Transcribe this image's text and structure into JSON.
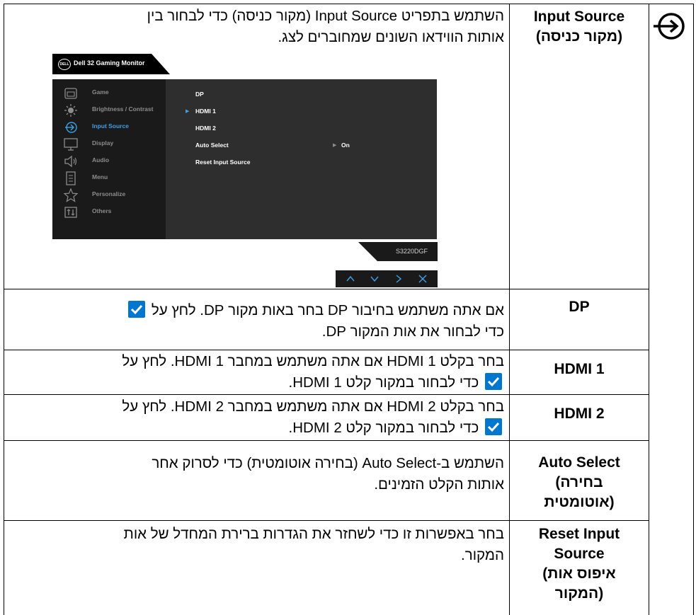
{
  "page": {
    "side_icon": "input-source-icon",
    "rows": [
      {
        "id": "input-source",
        "label_en": "Input Source",
        "label_he": "(מקור כניסה)",
        "desc": [
          "השתמש בתפריט Input Source (מקור כניסה) כדי לבחור בין",
          "אותות הווידאו השונים שמחוברים לצג."
        ]
      },
      {
        "id": "dp",
        "label_en": "DP",
        "desc_a": "אם אתה משתמש בחיבור DP בחר באות מקור DP. לחץ על",
        "desc_b": "כדי לבחור את אות המקור DP."
      },
      {
        "id": "hdmi1",
        "label_en": "HDMI 1",
        "desc_a": "בחר בקלט HDMI 1 אם אתה משתמש במחבר HDMI 1. לחץ על",
        "desc_b": "כדי לבחור במקור קלט HDMI 1."
      },
      {
        "id": "hdmi2",
        "label_en": "HDMI 2",
        "desc_a": "בחר בקלט HDMI 2 אם אתה משתמש במחבר HDMI 2. לחץ על",
        "desc_b": "כדי לבחור במקור קלט HDMI 2."
      },
      {
        "id": "auto-select",
        "label_en": "Auto Select",
        "label_he_1": "(בחירה",
        "label_he_2": "אוטומטית)",
        "desc": [
          "השתמש ב-Auto Select (בחירה אוטומטית) כדי לסרוק אחר",
          "אותות הקלט הזמינים."
        ]
      },
      {
        "id": "reset-input-source",
        "label_en_1": "Reset Input",
        "label_en_2": "Source",
        "label_he_1": "(איפוס אות",
        "label_he_2": "המקור)",
        "desc": [
          "בחר באפשרות זו כדי לשחזר את הגדרות ברירת המחדל של אות",
          "המקור."
        ]
      }
    ]
  },
  "osd": {
    "title": "Dell 32 Gaming Monitor",
    "logo": "DELL",
    "menu": [
      {
        "label": "Game",
        "icon": "game-icon",
        "active": false
      },
      {
        "label": "Brightness / Contrast",
        "icon": "brightness-icon",
        "active": false
      },
      {
        "label": "Input Source",
        "icon": "input-source-icon",
        "active": true
      },
      {
        "label": "Display",
        "icon": "display-icon",
        "active": false
      },
      {
        "label": "Audio",
        "icon": "audio-icon",
        "active": false
      },
      {
        "label": "Menu",
        "icon": "menu-icon",
        "active": false
      },
      {
        "label": "Personalize",
        "icon": "star-icon",
        "active": false
      },
      {
        "label": "Others",
        "icon": "others-icon",
        "active": false
      }
    ],
    "options": [
      "DP",
      "HDMI 1",
      "HDMI 2",
      "Auto Select",
      "Reset Input Source"
    ],
    "selected_option": "HDMI 1",
    "auto_select_value": "On",
    "model": "S3220DGF",
    "nav_buttons": [
      "up-icon",
      "down-icon",
      "right-icon",
      "close-icon"
    ],
    "accent_color": "#3fa0e8"
  },
  "colors": {
    "checkmark_bg": "#0076ce"
  }
}
